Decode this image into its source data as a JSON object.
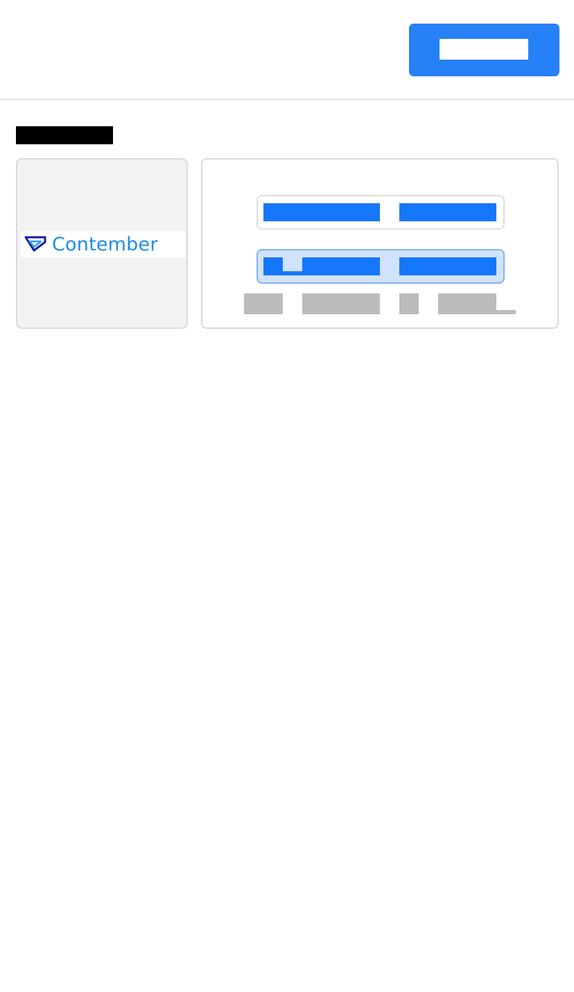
{
  "brand": {
    "name": "Contember",
    "text_color": "#1b8cf0",
    "mark_color_dark": "#1a1aa8",
    "mark_color_light": "#2b9cf5"
  },
  "colors": {
    "primary": "#2680f6",
    "option_selected_bg": "#d1e2fb",
    "option_selected_border": "#82b3f3",
    "redacted_gray": "#bbbbbb"
  }
}
